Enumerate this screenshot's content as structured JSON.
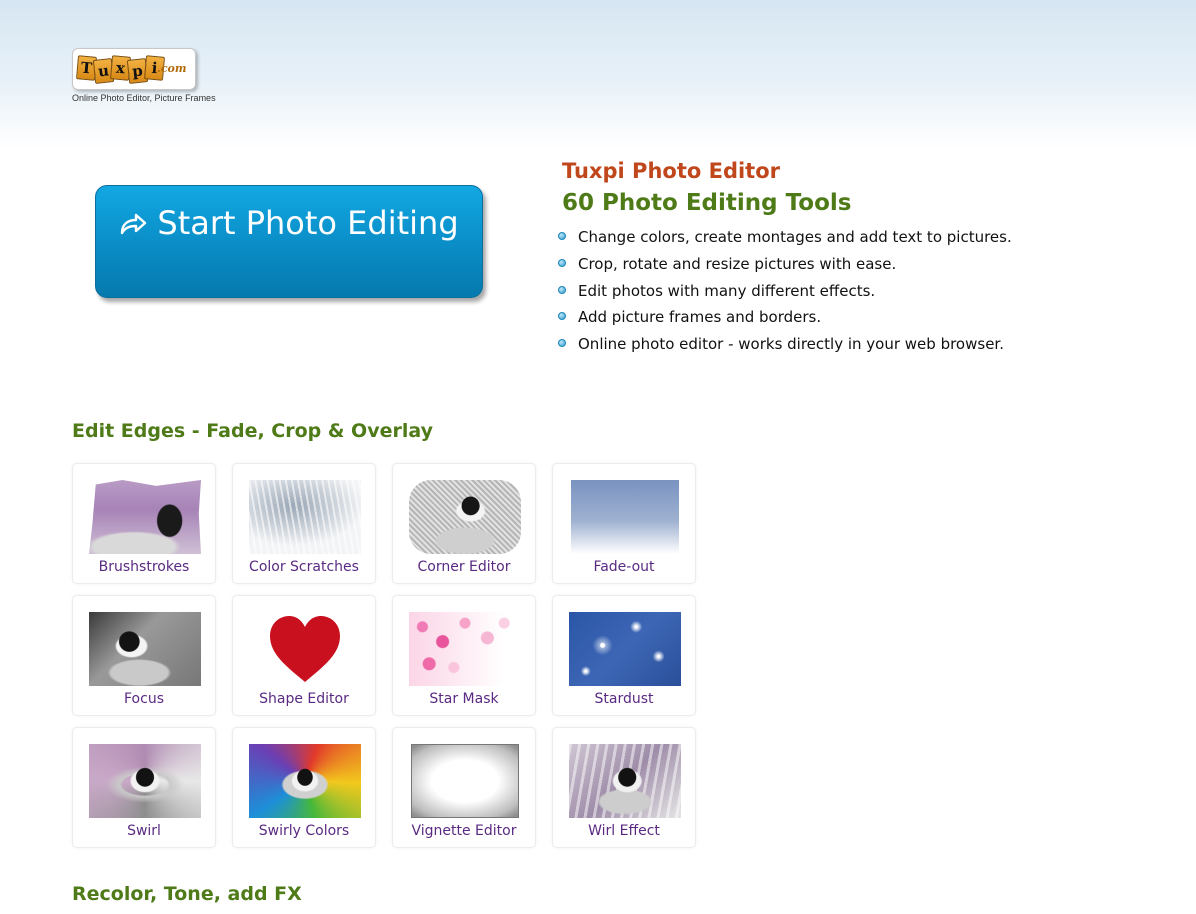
{
  "header": {
    "logo_text": "Tuxpi",
    "logo_letters": [
      "T",
      "u",
      "x",
      "p",
      "i"
    ],
    "logo_suffix": ".com",
    "tagline": "Online Photo Editor, Picture Frames"
  },
  "cta": {
    "label": "Start Photo Editing",
    "icon": "share-arrow-icon",
    "color_top": "#12a8e2",
    "color_bottom": "#0679ad"
  },
  "info": {
    "title": "Tuxpi Photo Editor",
    "subtitle": "60 Photo Editing Tools",
    "bullets": [
      "Change colors, create montages and add text to pictures.",
      "Crop, rotate and resize pictures with ease.",
      "Edit photos with many different effects.",
      "Add picture frames and borders.",
      "Online photo editor - works directly in your web browser."
    ]
  },
  "sections": [
    {
      "title": "Edit Edges - Fade, Crop & Overlay",
      "tools": [
        "Brushstrokes",
        "Color Scratches",
        "Corner Editor",
        "Fade-out",
        "Focus",
        "Shape Editor",
        "Star Mask",
        "Stardust",
        "Swirl",
        "Swirly Colors",
        "Vignette Editor",
        "Wirl Effect"
      ]
    },
    {
      "title": "Recolor, Tone, add FX",
      "tools": []
    }
  ],
  "colors": {
    "accent_red": "#c0471b",
    "accent_green": "#4e7a18",
    "tool_label": "#5a2a82"
  }
}
